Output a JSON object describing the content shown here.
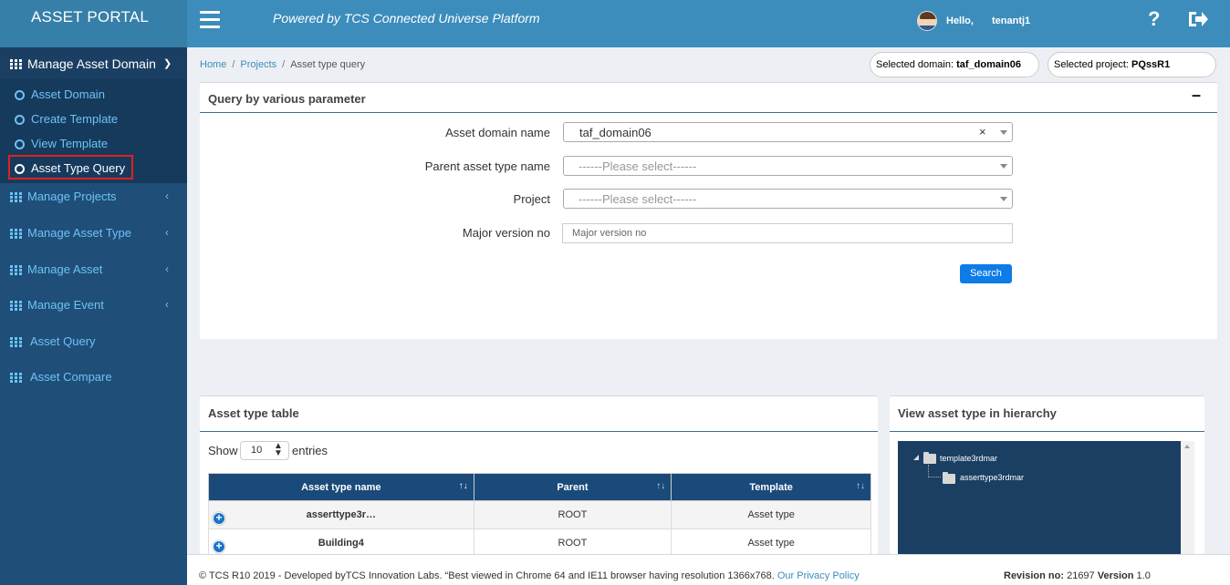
{
  "header": {
    "brand": "ASSET PORTAL",
    "tagline": "Powered by TCS Connected Universe Platform",
    "hello": "Hello,",
    "username": "tenantj1",
    "help_label": "?"
  },
  "sidebar": {
    "section": "Manage Asset Domain",
    "sub_items": [
      {
        "label": "Asset Domain"
      },
      {
        "label": "Create Template"
      },
      {
        "label": "View Template"
      },
      {
        "label": "Asset Type Query",
        "active": true
      }
    ],
    "items": [
      {
        "label": "Manage Projects"
      },
      {
        "label": "Manage Asset Type"
      },
      {
        "label": "Manage Asset"
      },
      {
        "label": "Manage Event"
      },
      {
        "label": "Asset Query"
      },
      {
        "label": "Asset Compare"
      }
    ]
  },
  "breadcrumb": {
    "home": "Home",
    "projects": "Projects",
    "current": "Asset type query"
  },
  "selection": {
    "domain_label": "Selected domain:",
    "domain_value": "taf_domain06",
    "project_label": "Selected project:",
    "project_value": "PQssR1"
  },
  "query_panel": {
    "title": "Query by various parameter",
    "collapse": "–",
    "fields": {
      "asset_domain_label": "Asset domain name",
      "asset_domain_value": "taf_domain06",
      "clear": "×",
      "parent_label": "Parent asset type name",
      "parent_placeholder": "------Please select------",
      "project_label": "Project",
      "project_placeholder": "------Please select------",
      "major_label": "Major version no",
      "major_placeholder": "Major version no"
    },
    "search_button": "Search"
  },
  "table_panel": {
    "title": "Asset type table",
    "show": "Show",
    "page_length": "10",
    "entries": "entries",
    "columns": [
      "Asset type name",
      "Parent",
      "Template"
    ],
    "sort_glyph": "↑↓",
    "expand_glyph": "+",
    "rows": [
      {
        "name": "asserttype3r…",
        "parent": "ROOT",
        "template": "Asset type"
      },
      {
        "name": "Building4",
        "parent": "ROOT",
        "template": "Asset type"
      }
    ]
  },
  "hierarchy_panel": {
    "title": "View asset type in hierarchy",
    "root": "template3rdmar",
    "child": "asserttype3rdmar"
  },
  "footer": {
    "copyright": "© TCS R10 2019 - Developed byTCS Innovation Labs. “Best viewed in Chrome 64 and IE11 browser having resolution 1366x768.",
    "privacy_link": "Our Privacy Policy",
    "revision_label": "Revision no:",
    "revision_value": "21697",
    "version_label": "Version",
    "version_value": "1.0"
  },
  "colors": {
    "header_bg": "#3c8dbc",
    "sidebar_bg": "#1f4e79",
    "table_header_bg": "#1a4a7a",
    "accent_button": "#0e7ce6",
    "active_highlight": "#e02020"
  }
}
